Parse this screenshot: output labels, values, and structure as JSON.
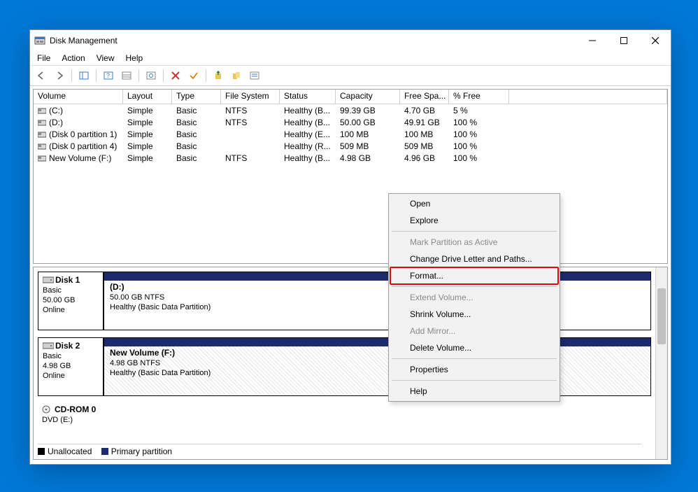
{
  "title": "Disk Management",
  "menubar": {
    "file": "File",
    "action": "Action",
    "view": "View",
    "help": "Help"
  },
  "columns": {
    "volume": "Volume",
    "layout": "Layout",
    "type": "Type",
    "fs": "File System",
    "status": "Status",
    "capacity": "Capacity",
    "free": "Free Spa...",
    "pct": "% Free"
  },
  "volumes": [
    {
      "name": "(C:)",
      "layout": "Simple",
      "type": "Basic",
      "fs": "NTFS",
      "status": "Healthy (B...",
      "capacity": "99.39 GB",
      "free": "4.70 GB",
      "pct": "5 %"
    },
    {
      "name": "(D:)",
      "layout": "Simple",
      "type": "Basic",
      "fs": "NTFS",
      "status": "Healthy (B...",
      "capacity": "50.00 GB",
      "free": "49.91 GB",
      "pct": "100 %"
    },
    {
      "name": "(Disk 0 partition 1)",
      "layout": "Simple",
      "type": "Basic",
      "fs": "",
      "status": "Healthy (E...",
      "capacity": "100 MB",
      "free": "100 MB",
      "pct": "100 %"
    },
    {
      "name": "(Disk 0 partition 4)",
      "layout": "Simple",
      "type": "Basic",
      "fs": "",
      "status": "Healthy (R...",
      "capacity": "509 MB",
      "free": "509 MB",
      "pct": "100 %"
    },
    {
      "name": "New Volume (F:)",
      "layout": "Simple",
      "type": "Basic",
      "fs": "NTFS",
      "status": "Healthy (B...",
      "capacity": "4.98 GB",
      "free": "4.96 GB",
      "pct": "100 %"
    }
  ],
  "disks": {
    "d1": {
      "title": "Disk 1",
      "type": "Basic",
      "size": "50.00 GB",
      "state": "Online",
      "vol_title": "(D:)",
      "vol_line1": "50.00 GB NTFS",
      "vol_line2": "Healthy (Basic Data Partition)"
    },
    "d2": {
      "title": "Disk 2",
      "type": "Basic",
      "size": "4.98 GB",
      "state": "Online",
      "vol_title": "New Volume  (F:)",
      "vol_line1": "4.98 GB NTFS",
      "vol_line2": "Healthy (Basic Data Partition)"
    },
    "cd": {
      "title": "CD-ROM 0",
      "type": "DVD (E:)"
    }
  },
  "legend": {
    "unalloc": "Unallocated",
    "primary": "Primary partition"
  },
  "context_menu": {
    "open": "Open",
    "explore": "Explore",
    "mark_active": "Mark Partition as Active",
    "change_letter": "Change Drive Letter and Paths...",
    "format": "Format...",
    "extend": "Extend Volume...",
    "shrink": "Shrink Volume...",
    "add_mirror": "Add Mirror...",
    "delete": "Delete Volume...",
    "properties": "Properties",
    "help": "Help"
  }
}
